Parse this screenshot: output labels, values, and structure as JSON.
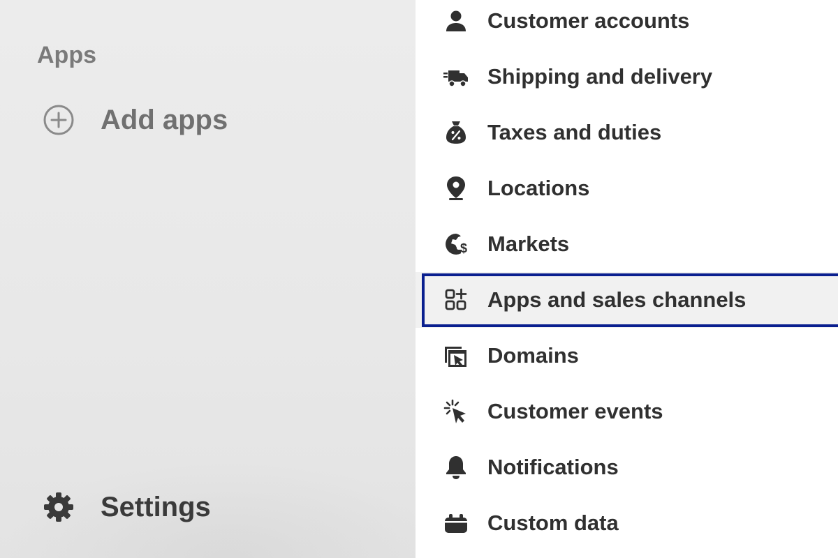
{
  "sidebar": {
    "apps_heading": "Apps",
    "add_apps": {
      "label": "Add apps",
      "icon": "plus-circle-icon"
    },
    "settings": {
      "label": "Settings",
      "icon": "gear-icon"
    }
  },
  "settings_menu": {
    "items": [
      {
        "label": "Customer accounts",
        "icon": "person-icon"
      },
      {
        "label": "Shipping and delivery",
        "icon": "delivery-truck-icon"
      },
      {
        "label": "Taxes and duties",
        "icon": "money-bag-percent-icon"
      },
      {
        "label": "Locations",
        "icon": "location-pin-icon"
      },
      {
        "label": "Markets",
        "icon": "globe-dollar-icon"
      },
      {
        "label": "Apps and sales channels",
        "icon": "apps-grid-plus-icon",
        "selected": true
      },
      {
        "label": "Domains",
        "icon": "domain-window-icon"
      },
      {
        "label": "Customer events",
        "icon": "cursor-click-icon"
      },
      {
        "label": "Notifications",
        "icon": "bell-icon"
      },
      {
        "label": "Custom data",
        "icon": "custom-data-icon"
      }
    ]
  },
  "colors": {
    "selection_border": "#0a1f8f",
    "selected_bg": "#f1f1f1",
    "sidebar_bg": "#ebebeb",
    "menu_text": "#303030"
  }
}
